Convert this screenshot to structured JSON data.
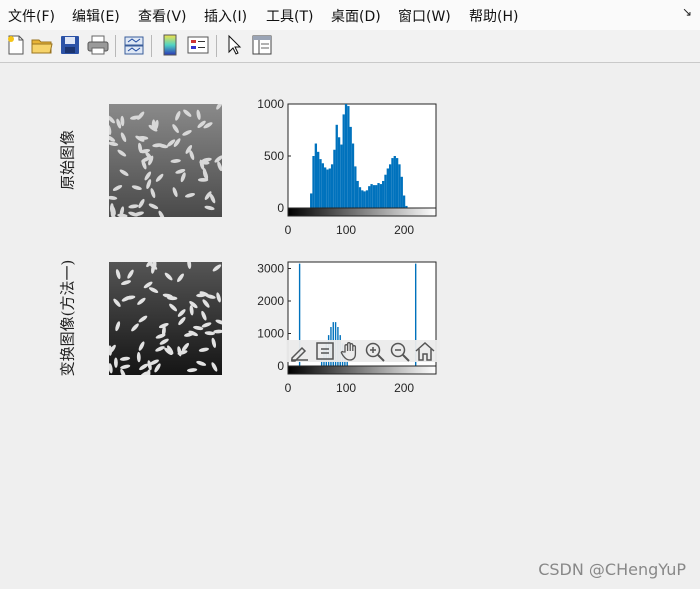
{
  "menu": [
    "文件(F)",
    "编辑(E)",
    "查看(V)",
    "插入(I)",
    "工具(T)",
    "桌面(D)",
    "窗口(W)",
    "帮助(H)"
  ],
  "toolbar_icons": [
    "new-figure-icon",
    "open-file-icon",
    "save-icon",
    "print-icon",
    "link-plot-icon",
    "insert-colorbar-icon",
    "insert-legend-icon",
    "select-arrow-icon",
    "property-inspector-icon"
  ],
  "dock_arrow": "↘",
  "rows": [
    {
      "label": "原始图像"
    },
    {
      "label": "变换图像(方法一)"
    }
  ],
  "axes_toolbar_icons": [
    "brush-icon",
    "data-tips-icon",
    "pan-hand-icon",
    "zoom-in-icon",
    "zoom-out-icon",
    "home-icon"
  ],
  "watermark": "CSDN @CHengYuP",
  "chart_data": [
    {
      "type": "bar",
      "title": "",
      "xlabel": "",
      "ylabel": "",
      "xlim": [
        0,
        255
      ],
      "ylim": [
        0,
        1000
      ],
      "xticks": [
        "0",
        "100",
        "200"
      ],
      "yticks": [
        "0",
        "500",
        "1000"
      ],
      "color": "#0072bd",
      "x": [
        40,
        44,
        48,
        52,
        56,
        60,
        64,
        68,
        72,
        76,
        80,
        84,
        88,
        92,
        96,
        100,
        104,
        108,
        112,
        116,
        120,
        124,
        128,
        132,
        136,
        140,
        144,
        148,
        152,
        156,
        160,
        164,
        168,
        172,
        176,
        180,
        184,
        188,
        192,
        196,
        200,
        204
      ],
      "values": [
        140,
        500,
        620,
        540,
        470,
        430,
        390,
        370,
        380,
        420,
        560,
        800,
        680,
        610,
        900,
        1000,
        980,
        780,
        620,
        400,
        260,
        200,
        170,
        160,
        170,
        210,
        230,
        220,
        220,
        240,
        230,
        260,
        320,
        380,
        420,
        480,
        500,
        480,
        420,
        300,
        120,
        20
      ]
    },
    {
      "type": "bar",
      "title": "",
      "xlabel": "",
      "ylabel": "",
      "xlim": [
        0,
        255
      ],
      "ylim": [
        0,
        3200
      ],
      "xticks": [
        "0",
        "100",
        "200"
      ],
      "yticks": [
        "0",
        "1000",
        "2000",
        "3000"
      ],
      "color": "#0072bd",
      "x": [
        20,
        58,
        62,
        66,
        70,
        74,
        78,
        82,
        86,
        90,
        94,
        98,
        102,
        220
      ],
      "values": [
        3150,
        250,
        500,
        700,
        950,
        1200,
        1350,
        1350,
        1200,
        950,
        700,
        400,
        150,
        3150
      ]
    }
  ]
}
